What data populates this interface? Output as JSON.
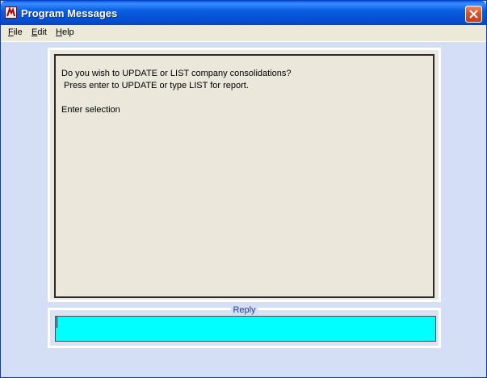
{
  "window": {
    "title": "Program Messages"
  },
  "menu": {
    "items": [
      {
        "label_acc": "F",
        "label_rest": "ile"
      },
      {
        "label_acc": "E",
        "label_rest": "dit"
      },
      {
        "label_acc": "H",
        "label_rest": "elp"
      }
    ]
  },
  "message": {
    "lines": [
      "Do you wish to UPDATE or LIST company consolidations?",
      " Press enter to UPDATE or type LIST for report.",
      "Enter selection"
    ]
  },
  "reply": {
    "label": "Reply",
    "value": ""
  },
  "colors": {
    "reply_background": "#00ffff",
    "reply_label": "#1f3ea8",
    "titlebar": "#0550d4"
  }
}
